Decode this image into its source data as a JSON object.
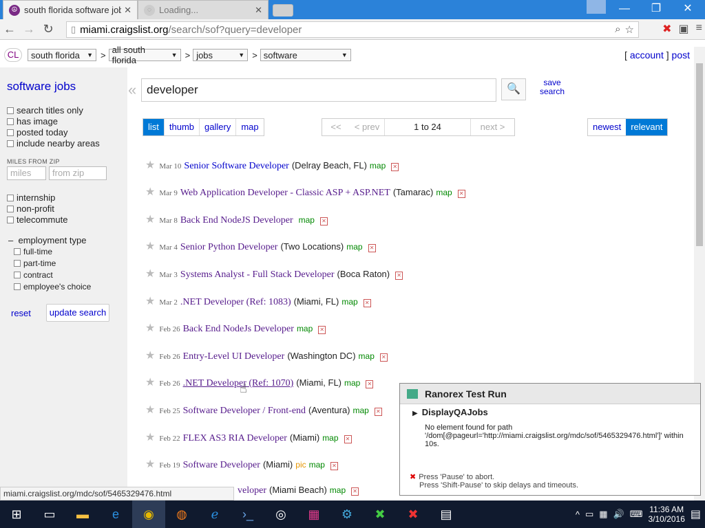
{
  "browser": {
    "tabs": [
      {
        "title": "south florida software jobs",
        "active": true
      },
      {
        "title": "Loading...",
        "active": false
      }
    ],
    "address": {
      "host": "miami.craigslist.org",
      "path": "/search/sof?query=developer"
    }
  },
  "cl": {
    "logo": "CL",
    "area": "south florida",
    "subarea": "all south florida",
    "category": "jobs",
    "subcategory": "software",
    "separator": ">",
    "account": "account",
    "post": "post"
  },
  "sidebar": {
    "title": "software jobs",
    "filters": [
      "search titles only",
      "has image",
      "posted today",
      "include nearby areas"
    ],
    "miles_label": "MILES FROM ZIP",
    "miles_placeholder": "miles",
    "zip_placeholder": "from zip",
    "types": [
      "internship",
      "non-profit",
      "telecommute"
    ],
    "employment_header": "employment type",
    "employment_types": [
      "full-time",
      "part-time",
      "contract",
      "employee's choice"
    ],
    "reset": "reset",
    "update": "update search"
  },
  "search": {
    "query": "developer",
    "save": "save search"
  },
  "views": [
    "list",
    "thumb",
    "gallery",
    "map"
  ],
  "active_view": "list",
  "pager": {
    "first": "<<",
    "prev": "< prev",
    "range": "1 to 24",
    "next": "next >"
  },
  "sort": {
    "newest": "newest",
    "relevant": "relevant",
    "active": "relevant"
  },
  "results": [
    {
      "date": "Mar 10",
      "title": "Senior Software Developer",
      "loc": "(Delray Beach, FL)",
      "map": "map",
      "pic": ""
    },
    {
      "date": "Mar 9",
      "title": "Web Application Developer - Classic ASP + ASP.NET",
      "loc": "(Tamarac)",
      "map": "map",
      "pic": ""
    },
    {
      "date": "Mar 8",
      "title": "Back End NodeJS Developer",
      "loc": "",
      "map": "map",
      "pic": ""
    },
    {
      "date": "Mar 4",
      "title": "Senior Python Developer",
      "loc": "(Two Locations)",
      "map": "map",
      "pic": ""
    },
    {
      "date": "Mar 3",
      "title": "Systems Analyst - Full Stack Developer",
      "loc": "(Boca Raton)",
      "map": "",
      "pic": ""
    },
    {
      "date": "Mar 2",
      "title": ".NET Developer (Ref: 1083)",
      "loc": "(Miami, FL)",
      "map": "map",
      "pic": ""
    },
    {
      "date": "Feb 26",
      "title": "Back End NodeJs Developer",
      "loc": "",
      "map": "map",
      "pic": ""
    },
    {
      "date": "Feb 26",
      "title": "Entry-Level UI Developer",
      "loc": "(Washington DC)",
      "map": "map",
      "pic": ""
    },
    {
      "date": "Feb 26",
      "title": ".NET Developer (Ref: 1070)",
      "loc": "(Miami, FL)",
      "map": "map",
      "pic": ""
    },
    {
      "date": "Feb 25",
      "title": "Software Developer / Front-end",
      "loc": "(Aventura)",
      "map": "map",
      "pic": ""
    },
    {
      "date": "Feb 22",
      "title": "FLEX AS3 RIA Developer",
      "loc": "(Miami)",
      "map": "map",
      "pic": ""
    },
    {
      "date": "Feb 19",
      "title": "Software Developer",
      "loc": "(Miami)",
      "map": "map",
      "pic": "pic"
    },
    {
      "date": "",
      "title": "veloper",
      "loc": "(Miami Beach)",
      "map": "map",
      "pic": ""
    }
  ],
  "status_url": "miami.craigslist.org/mdc/sof/5465329476.html",
  "ranorex": {
    "title": "Ranorex Test Run",
    "step": "DisplayQAJobs",
    "message": "No element found for path '/dom[@pageurl='http://miami.craigslist.org/mdc/sof/5465329476.html']' within 10s.",
    "hint1": "Press 'Pause' to abort.",
    "hint2": "Press 'Shift-Pause' to skip delays and timeouts."
  },
  "clock": {
    "time": "11:36 AM",
    "date": "3/10/2016"
  }
}
